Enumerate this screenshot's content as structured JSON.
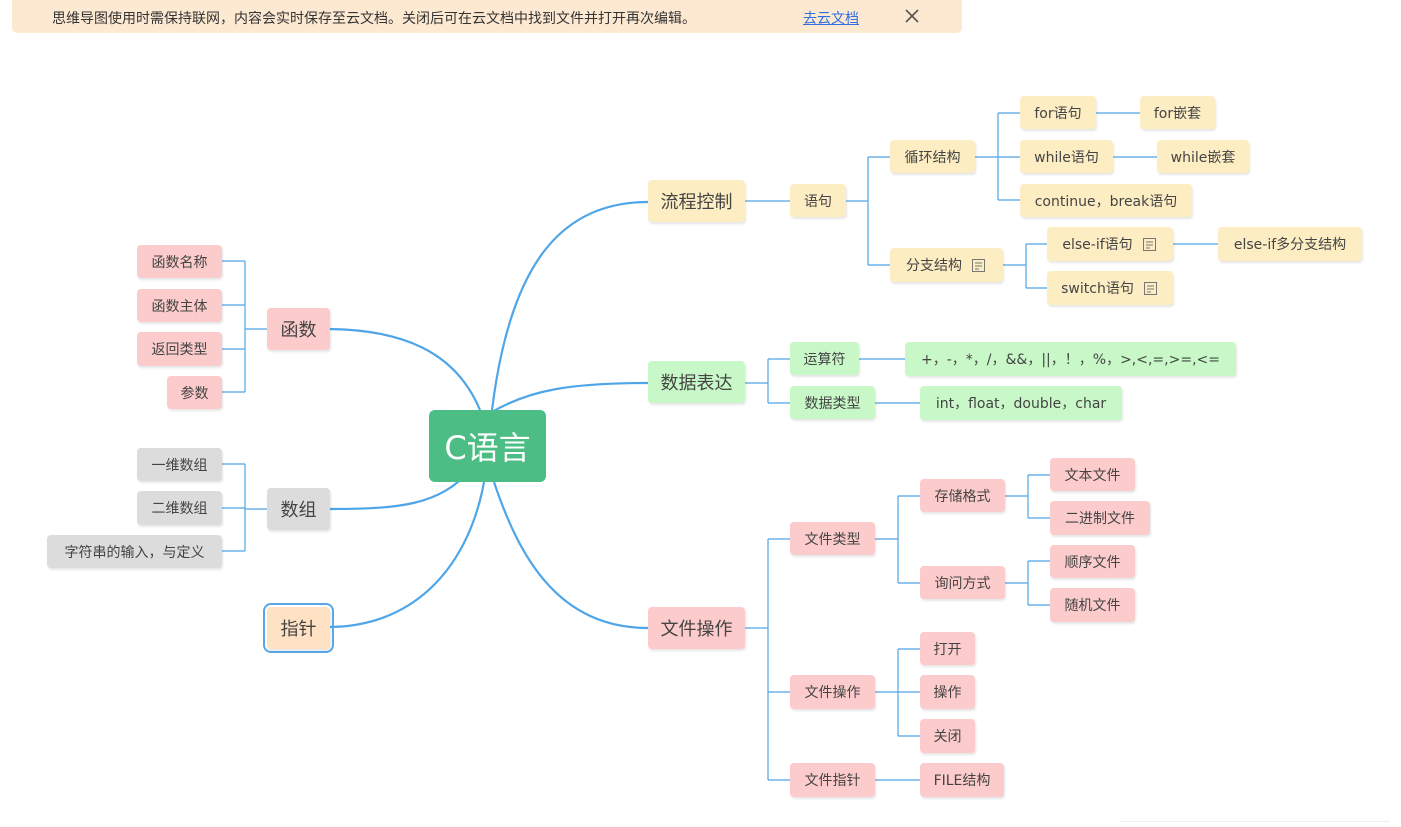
{
  "banner": {
    "message": "思维导图使用时需保持联网，内容会实时保存至云文档。关闭后可在云文档中找到文件并打开再次编辑。",
    "link_text": "去云文档",
    "close_icon": "close-icon"
  },
  "colors": {
    "root": "#4cbd84",
    "connector": "#4ea5e8",
    "branch_yellow": "#fdedc3",
    "branch_green": "#c8f8c7",
    "branch_pink": "#fccbcb",
    "branch_gray": "#dcdcdc",
    "branch_peach": "#ffe2c3",
    "selection": "#5aa5e6"
  },
  "mindmap": {
    "root": "C语言",
    "flow": {
      "label": "流程控制",
      "statement": "语句",
      "loop": "循环结构",
      "for_stmt": "for语句",
      "for_nest": "for嵌套",
      "while_stmt": "while语句",
      "while_nest": "while嵌套",
      "continue_break": "continue，break语句",
      "branch": "分支结构",
      "else_if": "else-if语句",
      "else_if_multi": "else-if多分支结构",
      "switch": "switch语句",
      "note_icon": "note-icon"
    },
    "expr": {
      "label": "数据表达",
      "operators": "运算符",
      "operator_list": "+，-，*，/，&&，||，！，%，>,<,=,>=,<=",
      "types": "数据类型",
      "type_list": "int，float，double，char"
    },
    "file": {
      "label": "文件操作",
      "file_type": "文件类型",
      "storage_format": "存储格式",
      "text_file": "文本文件",
      "binary_file": "二进制文件",
      "access_mode": "询问方式",
      "sequential_file": "顺序文件",
      "random_file": "随机文件",
      "file_ops": "文件操作",
      "open": "打开",
      "operate": "操作",
      "close": "关闭",
      "file_pointer": "文件指针",
      "file_struct": "FILE结构"
    },
    "func": {
      "label": "函数",
      "name": "函数名称",
      "body": "函数主体",
      "return_type": "返回类型",
      "params": "参数"
    },
    "array": {
      "label": "数组",
      "one_dim": "一维数组",
      "two_dim": "二维数组",
      "string": "字符串的输入，与定义"
    },
    "pointer": {
      "label": "指针"
    }
  }
}
